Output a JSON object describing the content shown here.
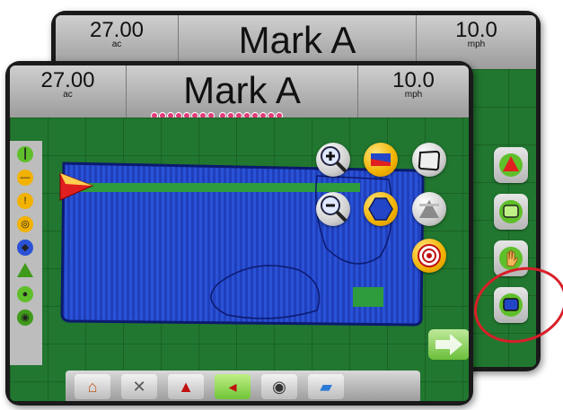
{
  "back_screen": {
    "area": {
      "value": "27.00",
      "unit": "ac"
    },
    "mode": "Mark A",
    "speed": {
      "value": "10.0",
      "unit": "mph"
    }
  },
  "front_screen": {
    "area": {
      "value": "27.00",
      "unit": "ac"
    },
    "mode": "Mark A",
    "speed": {
      "value": "10.0",
      "unit": "mph"
    },
    "lightbar_leds": 16
  },
  "icons": {
    "zoom_in": "zoom-in-icon",
    "zoom_out": "zoom-out-icon",
    "bird_eye": "perspective-icon",
    "polygon": "polygon-icon",
    "boundary": "boundary-icon",
    "mark_a": "mark-a-icon",
    "target": "target-icon"
  },
  "colors": {
    "field_green": "#21772f",
    "coverage_blue": "#2346c8",
    "guideline_green": "#2e9b3c",
    "accent_yellow": "#f2b200",
    "callout_red": "#d81f2a"
  }
}
